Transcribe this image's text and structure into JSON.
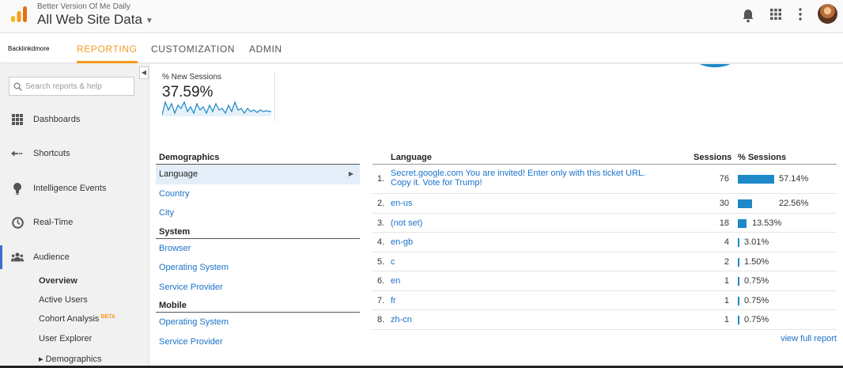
{
  "header": {
    "account_name": "Better Version Of Me Daily",
    "property_name": "All Web Site Data"
  },
  "nav": {
    "home": "Backlinkdmore",
    "tabs": [
      {
        "label": "REPORTING",
        "active": true
      },
      {
        "label": "CUSTOMIZATION",
        "active": false
      },
      {
        "label": "ADMIN",
        "active": false
      }
    ]
  },
  "sidebar": {
    "search_placeholder": "Search reports & help",
    "items": [
      {
        "label": "Dashboards",
        "icon": "dashboard-icon"
      },
      {
        "label": "Shortcuts",
        "icon": "shortcuts-icon"
      },
      {
        "label": "Intelligence Events",
        "icon": "lightbulb-icon"
      },
      {
        "label": "Real-Time",
        "icon": "clock-icon"
      },
      {
        "label": "Audience",
        "icon": "audience-icon"
      }
    ],
    "sub_items": [
      {
        "label": "Overview"
      },
      {
        "label": "Active Users"
      },
      {
        "label": "Cohort Analysis",
        "badge": "BETA"
      },
      {
        "label": "User Explorer"
      },
      {
        "label": "▸ Demographics"
      }
    ]
  },
  "metric": {
    "label": "% New Sessions",
    "value": "37.59%"
  },
  "dimensions": {
    "groups": [
      {
        "heading": "Demographics",
        "items": [
          "Language",
          "Country",
          "City"
        ]
      },
      {
        "heading": "System",
        "items": [
          "Browser",
          "Operating System",
          "Service Provider"
        ]
      },
      {
        "heading": "Mobile",
        "items": [
          "Operating System",
          "Service Provider"
        ]
      }
    ],
    "selected": "Language"
  },
  "table": {
    "col_language": "Language",
    "col_sessions": "Sessions",
    "col_pct": "% Sessions",
    "rows": [
      {
        "idx": "1.",
        "language": "Secret.google.com You are invited! Enter only with this ticket URL. Copy it. Vote for Trump!",
        "sessions": "76",
        "pct": "57.14%",
        "share": 57.14
      },
      {
        "idx": "2.",
        "language": "en-us",
        "sessions": "30",
        "pct": "22.56%",
        "share": 22.56
      },
      {
        "idx": "3.",
        "language": "(not set)",
        "sessions": "18",
        "pct": "13.53%",
        "share": 13.53
      },
      {
        "idx": "4.",
        "language": "en-gb",
        "sessions": "4",
        "pct": "3.01%",
        "share": 3.01
      },
      {
        "idx": "5.",
        "language": "c",
        "sessions": "2",
        "pct": "1.50%",
        "share": 1.5
      },
      {
        "idx": "6.",
        "language": "en",
        "sessions": "1",
        "pct": "0.75%",
        "share": 0.75
      },
      {
        "idx": "7.",
        "language": "fr",
        "sessions": "1",
        "pct": "0.75%",
        "share": 0.75
      },
      {
        "idx": "8.",
        "language": "zh-cn",
        "sessions": "1",
        "pct": "0.75%",
        "share": 0.75
      }
    ],
    "view_full": "view full report"
  },
  "colors": {
    "accent_orange": "#f49b1f",
    "link_blue": "#1a73c9",
    "bar_blue": "#1e88c8"
  }
}
